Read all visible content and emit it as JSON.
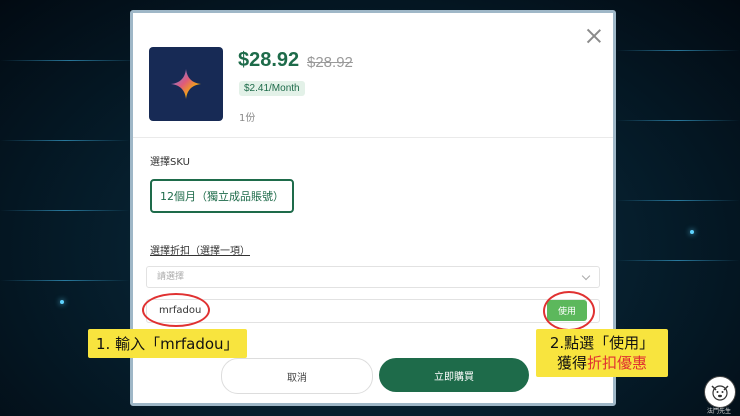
{
  "product": {
    "price": "$28.92",
    "original_price": "$28.92",
    "monthly": "$2.41/Month",
    "quantity": "1份"
  },
  "sku": {
    "label": "選擇SKU",
    "selected_option": "12個月（獨立成品賬號）"
  },
  "discount": {
    "label": "選擇折扣（選擇一項）",
    "select_placeholder": "請選擇"
  },
  "coupon": {
    "value": "mrfadou",
    "use_button": "使用"
  },
  "actions": {
    "cancel": "取消",
    "buy_now": "立即購買"
  },
  "annotations": {
    "step1": "1. 輸入「mrfadou」",
    "step2_line1": "2.點選「使用」",
    "step2_line2_prefix": "獲得",
    "step2_line2_highlight": "折扣優惠"
  },
  "watermark": "法鬥先生",
  "colors": {
    "brand_green": "#1e6b4a",
    "use_green": "#5cb85c",
    "annotation_red": "#e03131",
    "note_yellow": "#f8e43e"
  }
}
